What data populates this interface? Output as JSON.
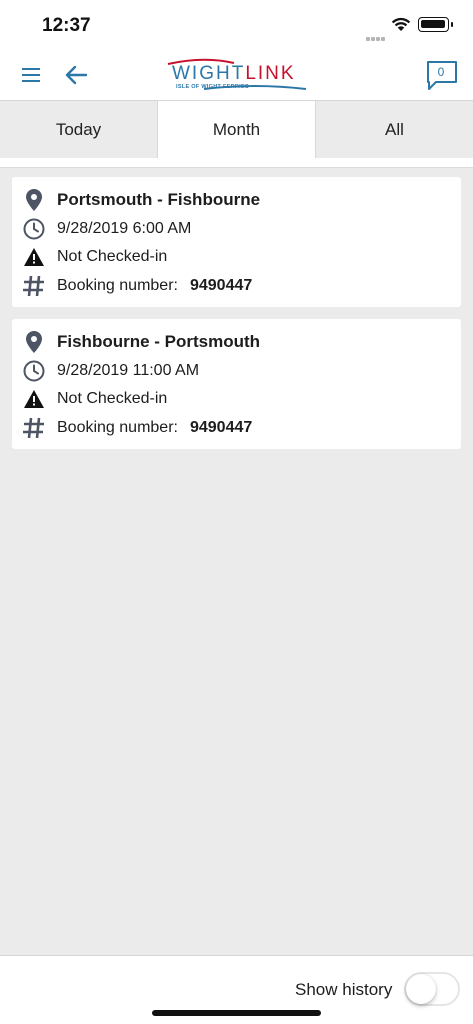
{
  "status_bar": {
    "time": "12:37"
  },
  "header": {
    "logo_text_part1": "WIGHT",
    "logo_text_part2": "LINK",
    "logo_subtitle": "ISLE OF WIGHT FERRIES",
    "message_count": "0"
  },
  "tabs": [
    {
      "label": "Today",
      "active": false
    },
    {
      "label": "Month",
      "active": true
    },
    {
      "label": "All",
      "active": false
    }
  ],
  "bookings": [
    {
      "route": "Portsmouth - Fishbourne",
      "datetime": "9/28/2019 6:00 AM",
      "status": "Not Checked-in",
      "booking_label": "Booking number:",
      "booking_number": "9490447"
    },
    {
      "route": "Fishbourne - Portsmouth",
      "datetime": "9/28/2019 11:00 AM",
      "status": "Not Checked-in",
      "booking_label": "Booking number:",
      "booking_number": "9490447"
    }
  ],
  "footer": {
    "show_history_label": "Show history",
    "show_history_on": false
  },
  "colors": {
    "brand_blue": "#2b77a8",
    "brand_red": "#c8102e",
    "icon_gray": "#4d5463",
    "background": "#ebebeb"
  }
}
